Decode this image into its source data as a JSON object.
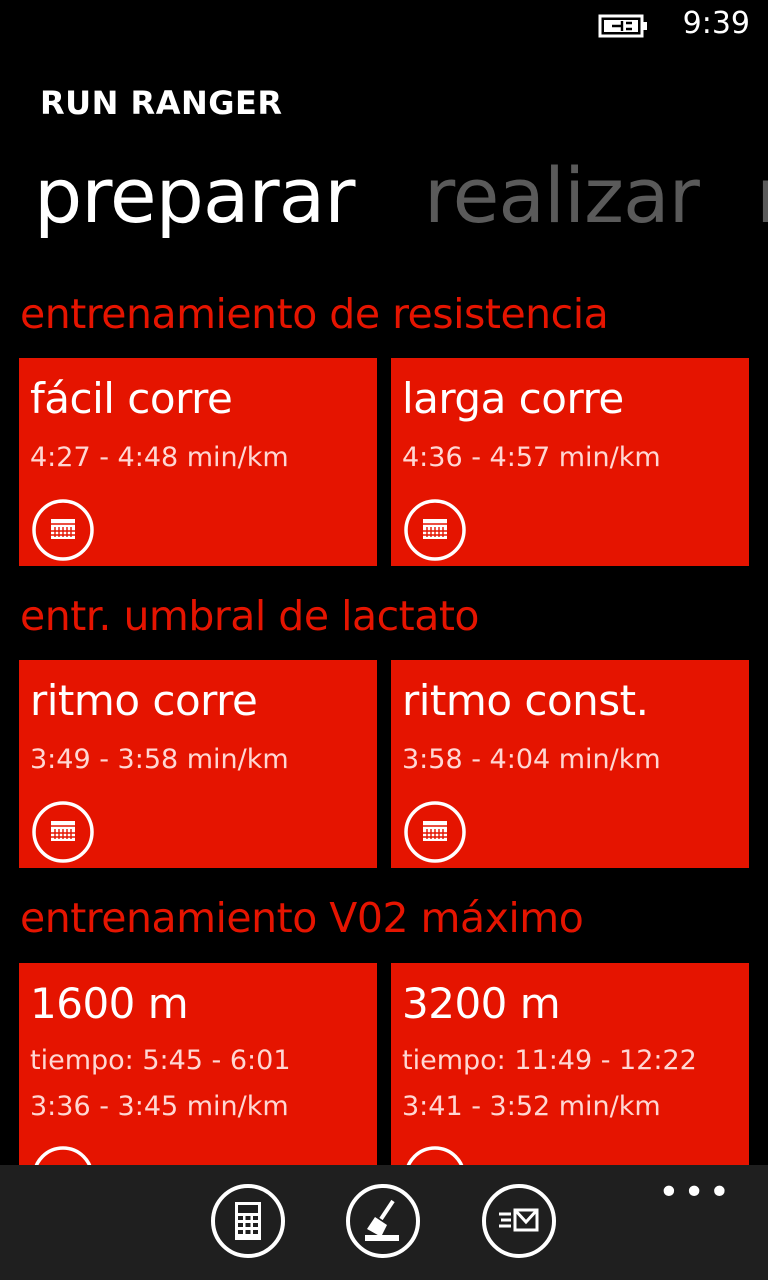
{
  "status": {
    "time": "9:39"
  },
  "app": {
    "title": "RUN RANGER"
  },
  "pivot": [
    {
      "label": "preparar",
      "active": true
    },
    {
      "label": "realizar",
      "active": false
    },
    {
      "label": "r",
      "active": false
    }
  ],
  "sections": [
    {
      "heading": "entrenamiento de resistencia",
      "tiles": [
        {
          "title": "fácil corre",
          "lines": [
            "4:27 - 4:48 min/km"
          ]
        },
        {
          "title": "larga corre",
          "lines": [
            "4:36 - 4:57 min/km"
          ]
        }
      ]
    },
    {
      "heading": "entr. umbral de lactato",
      "tiles": [
        {
          "title": "ritmo corre",
          "lines": [
            "3:49 - 3:58 min/km"
          ]
        },
        {
          "title": "ritmo const.",
          "lines": [
            "3:58 - 4:04 min/km"
          ]
        }
      ]
    },
    {
      "heading": "entrenamiento V02 máximo",
      "tiles": [
        {
          "title": "1600 m",
          "lines": [
            "tiempo: 5:45 - 6:01",
            "3:36 - 3:45 min/km"
          ]
        },
        {
          "title": "3200 m",
          "lines": [
            "tiempo: 11:49 - 12:22",
            "3:41 - 3:52 min/km"
          ]
        }
      ]
    }
  ],
  "appbar": {
    "buttons": [
      "calculator-icon",
      "broom-icon",
      "send-mail-icon"
    ],
    "more": "•••"
  },
  "colors": {
    "accent": "#e51400",
    "background": "#000000",
    "appbar": "#1f1f1f",
    "inactive_pivot": "#5a5a5a"
  }
}
